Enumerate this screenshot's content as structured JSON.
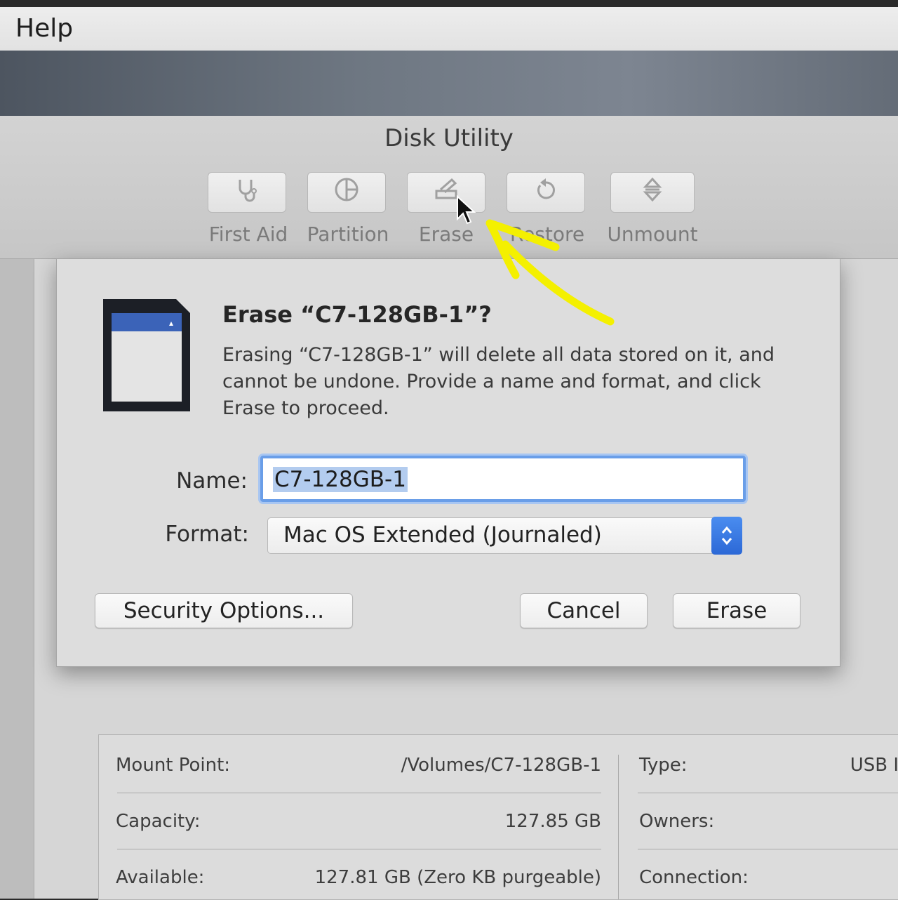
{
  "menubar": {
    "help": "Help"
  },
  "window": {
    "title": "Disk Utility"
  },
  "toolbar": {
    "buttons": [
      {
        "label": "First Aid",
        "icon": "stethoscope-icon"
      },
      {
        "label": "Partition",
        "icon": "pie-partition-icon"
      },
      {
        "label": "Erase",
        "icon": "erase-disk-icon"
      },
      {
        "label": "Restore",
        "icon": "restore-arrow-icon"
      },
      {
        "label": "Unmount",
        "icon": "eject-icon"
      }
    ]
  },
  "dialog": {
    "title": "Erase “C7-128GB-1”?",
    "message": "Erasing “C7-128GB-1” will delete all data stored on it, and cannot be undone. Provide a name and format, and click Erase to proceed.",
    "name_label": "Name:",
    "name_value": "C7-128GB-1",
    "format_label": "Format:",
    "format_value": "Mac OS Extended (Journaled)",
    "security_button": "Security Options...",
    "cancel_button": "Cancel",
    "erase_button": "Erase"
  },
  "info": {
    "mount_point_label": "Mount Point:",
    "mount_point_value": "/Volumes/C7-128GB-1",
    "capacity_label": "Capacity:",
    "capacity_value": "127.85 GB",
    "available_label": "Available:",
    "available_value": "127.81 GB (Zero KB purgeable)",
    "type_label": "Type:",
    "type_value": "USB I",
    "owners_label": "Owners:",
    "connection_label": "Connection:"
  },
  "colors": {
    "accent": "#2c68d6",
    "annotation": "#f4f000"
  }
}
